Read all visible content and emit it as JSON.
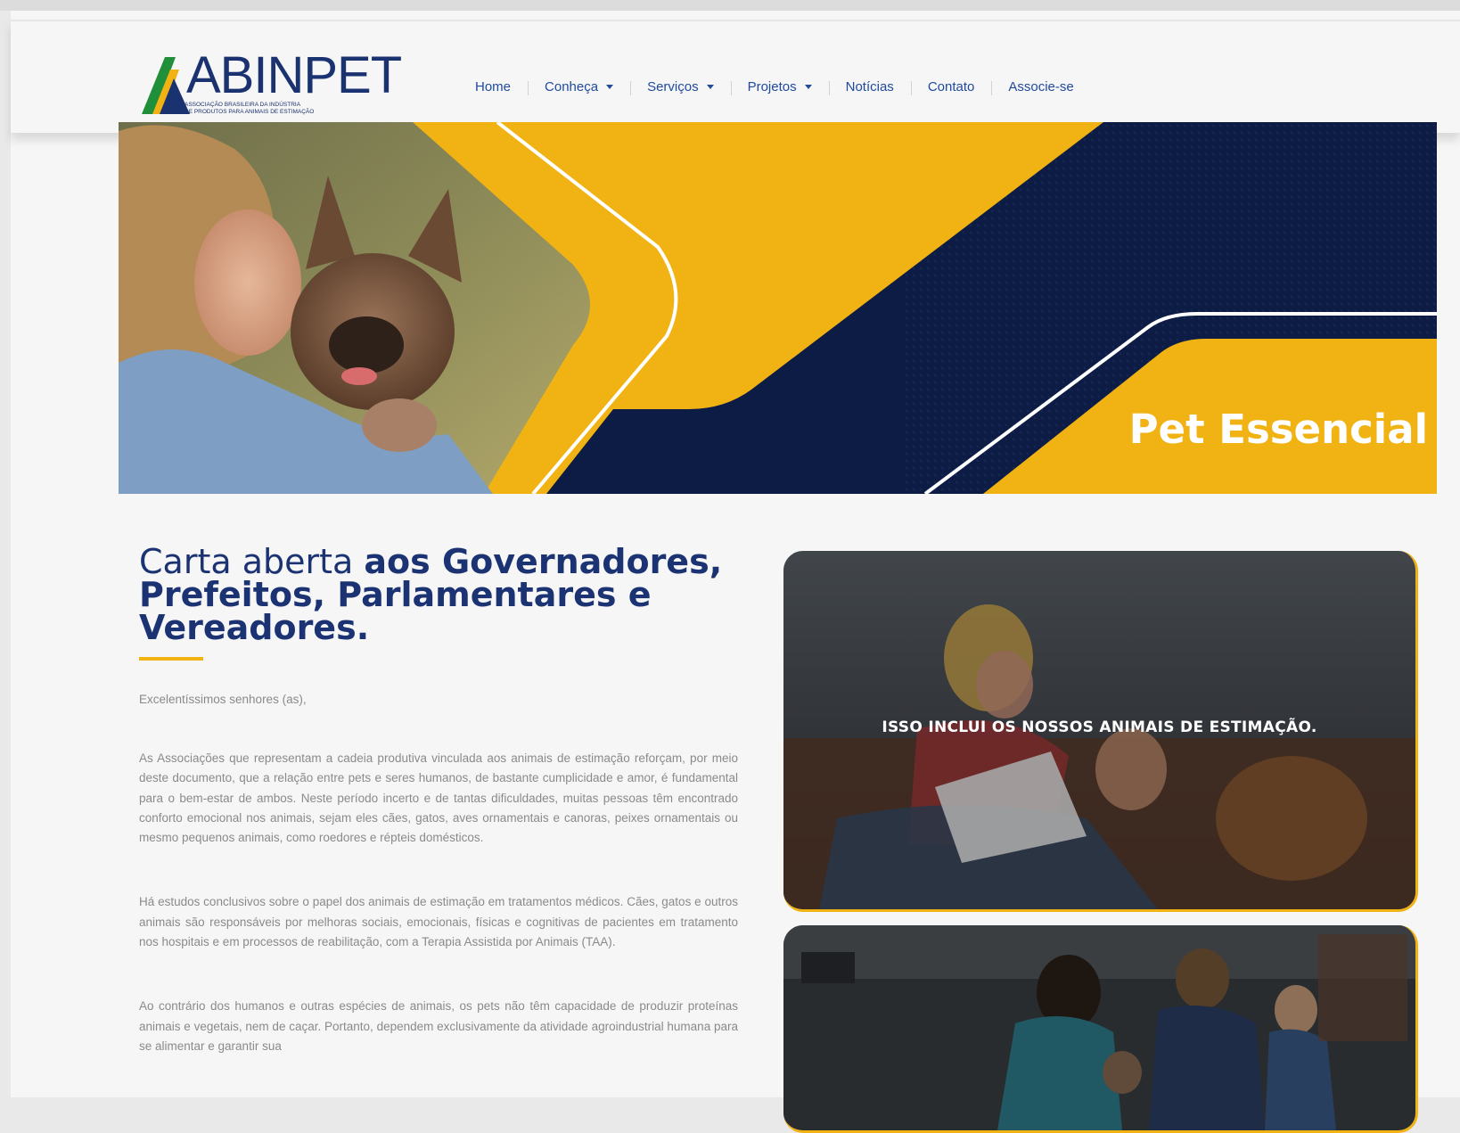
{
  "header": {
    "logo_text": "ABINPET",
    "logo_subtitle_line1": "ASSOCIAÇÃO BRASILEIRA DA INDÚSTRIA",
    "logo_subtitle_line2": "DE PRODUTOS PARA ANIMAIS DE ESTIMAÇÃO",
    "nav": [
      {
        "label": "Home",
        "has_dropdown": false
      },
      {
        "label": "Conheça",
        "has_dropdown": true
      },
      {
        "label": "Serviços",
        "has_dropdown": true
      },
      {
        "label": "Projetos",
        "has_dropdown": true
      },
      {
        "label": "Notícias",
        "has_dropdown": false
      },
      {
        "label": "Contato",
        "has_dropdown": false
      },
      {
        "label": "Associe-se",
        "has_dropdown": false
      }
    ]
  },
  "banner": {
    "title": "Pet Essencial"
  },
  "article": {
    "headline_light": "Carta aberta ",
    "headline_bold": "aos Governadores, Prefeitos, Parlamentares e Vereadores.",
    "greeting": "Excelentíssimos senhores (as),",
    "paragraphs": [
      "As Associações que representam a cadeia produtiva vinculada aos animais de estimação reforçam, por meio deste documento, que a relação entre pets e seres humanos, de bastante cumplicidade e amor, é fundamental para o bem-estar de ambos. Neste período incerto e de tantas dificuldades, muitas pessoas têm encontrado conforto emocional nos animais, sejam eles cães, gatos, aves ornamentais e canoras, peixes ornamentais ou mesmo pequenos animais, como roedores e répteis domésticos.",
      "Há estudos conclusivos sobre o papel dos animais de estimação em tratamentos médicos. Cães, gatos e outros animais são responsáveis por melhoras sociais, emocionais, físicas e cognitivas de pacientes em tratamento nos hospitais e em processos de reabilitação, com a Terapia Assistida por Animais (TAA).",
      "Ao contrário dos humanos e outras espécies de animais, os pets não têm capacidade de produzir proteínas animais e vegetais, nem de caçar. Portanto, dependem exclusivamente da atividade agroindustrial humana para se alimentar e garantir sua"
    ]
  },
  "cards": [
    {
      "caption": "ISSO INCLUI OS NOSSOS ANIMAIS DE ESTIMAÇÃO."
    },
    {
      "caption": ""
    }
  ],
  "colors": {
    "navy": "#0d1c45",
    "gold": "#f0b313",
    "nav_text": "#1f4aa0",
    "headline": "#1c3373",
    "body_text": "#8a8a8a"
  }
}
